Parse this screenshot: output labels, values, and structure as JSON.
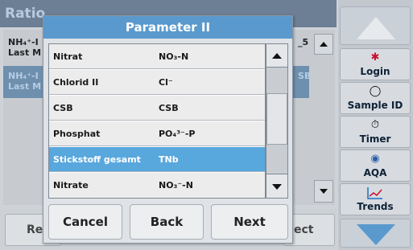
{
  "background": {
    "title": "Ratio",
    "rows": [
      {
        "line1": "NH₄⁺-I",
        "line2": "Last M",
        "right": "_5"
      },
      {
        "line1": "NH₄⁺-I",
        "line2": "Last M",
        "right": "SB"
      }
    ],
    "buttons": {
      "left": "Re",
      "right": "ect"
    }
  },
  "sidebar": {
    "items": [
      {
        "label": "Login",
        "icon": "person-icon"
      },
      {
        "label": "Sample ID",
        "icon": "vial-icon"
      },
      {
        "label": "Timer",
        "icon": "clock-icon"
      },
      {
        "label": "AQA",
        "icon": "aqa-icon"
      },
      {
        "label": "Trends",
        "icon": "chart-icon"
      }
    ]
  },
  "dialog": {
    "title": "Parameter II",
    "rows": [
      {
        "name": "Nitrat",
        "formula": "NO₃-N",
        "selected": false
      },
      {
        "name": "Chlorid II",
        "formula": "Cl⁻",
        "selected": false
      },
      {
        "name": "CSB",
        "formula": "CSB",
        "selected": false
      },
      {
        "name": "Phosphat",
        "formula": "PO₄³⁻-P",
        "selected": false
      },
      {
        "name": "Stickstoff gesamt",
        "formula": "TNb",
        "selected": true
      },
      {
        "name": "Nitrate",
        "formula": "NO₃⁻-N",
        "selected": false
      }
    ],
    "buttons": {
      "cancel": "Cancel",
      "back": "Back",
      "next": "Next"
    }
  },
  "colors": {
    "accent": "#5a99cd",
    "selected": "#58a7dd"
  }
}
